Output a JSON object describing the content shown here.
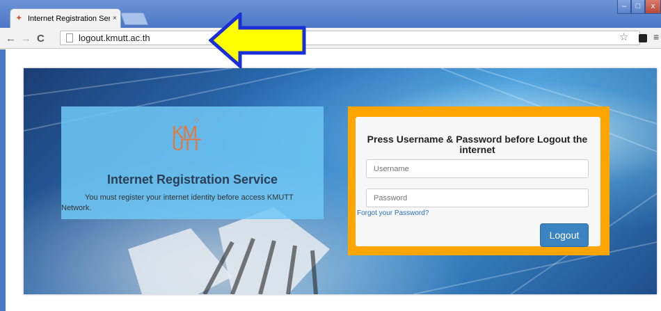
{
  "browser": {
    "tab_title": "Internet Registration Servi",
    "tab_close": "×",
    "url": "logout.kmutt.ac.th",
    "nav_back": "←",
    "nav_forward": "→",
    "nav_reload": "C",
    "star": "☆",
    "menu": "≡",
    "window_min": "–",
    "window_max": "□",
    "window_close": "x"
  },
  "logo": {
    "top": "KM",
    "bottom": "UTT",
    "dots": "⁘"
  },
  "info": {
    "title": "Internet Registration Service",
    "description": "You must register your internet identity before access KMUTT Network."
  },
  "login": {
    "heading": "Press Username & Password before Logout the internet",
    "username_placeholder": "Username",
    "password_placeholder": "Password",
    "forgot_label": "Forgot your Password?",
    "logout_label": "Logout"
  },
  "colors": {
    "accent_orange": "#ffa500",
    "logo_orange": "#e8763a",
    "button_blue": "#3b84c2",
    "arrow_yellow": "#ffff00",
    "arrow_outline": "#1a2fd8"
  }
}
